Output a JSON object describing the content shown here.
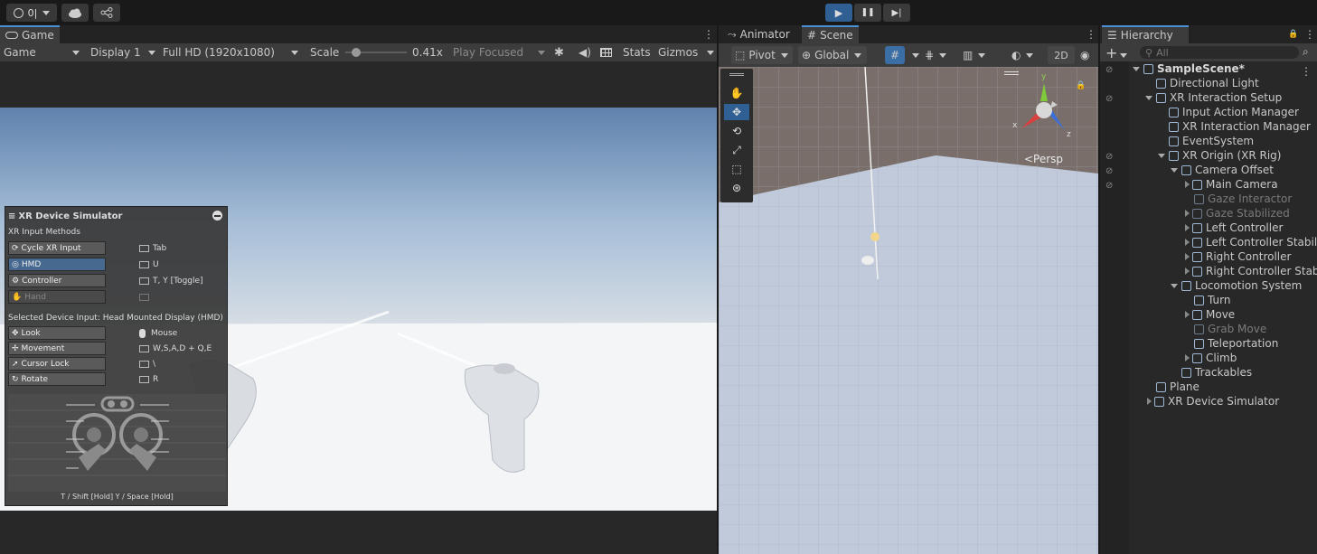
{
  "toolbar": {
    "account_label": "0|",
    "play": "▶",
    "pause": "❚❚",
    "step": "▶|"
  },
  "game": {
    "tab_label": "Game",
    "view_dropdown": "Game",
    "display": "Display 1",
    "resolution": "Full HD (1920x1080)",
    "scale_label": "Scale",
    "scale_value": "0.41x",
    "scale_fraction": 0.12,
    "play_mode": "Play Focused",
    "stats": "Stats",
    "gizmos": "Gizmos"
  },
  "simulator": {
    "title": "XR Device Simulator",
    "input_methods_header": "XR Input Methods",
    "methods": [
      {
        "label": "Cycle XR Input",
        "key": "Tab"
      },
      {
        "label": "HMD",
        "key": "U"
      },
      {
        "label": "Controller",
        "key": "T, Y [Toggle]"
      },
      {
        "label": "Hand",
        "key": ""
      }
    ],
    "selected_header": "Selected Device Input: Head Mounted Display (HMD)",
    "inputs": [
      {
        "label": "Look",
        "key": "Mouse"
      },
      {
        "label": "Movement",
        "key": "W,S,A,D + Q,E"
      },
      {
        "label": "Cursor Lock",
        "key": "\\"
      },
      {
        "label": "Rotate",
        "key": "R"
      }
    ],
    "footer": "T / Shift [Hold]   Y / Space [Hold]"
  },
  "scene": {
    "tabs": [
      "Animator",
      "Scene"
    ],
    "pivot": "Pivot",
    "global": "Global",
    "mode_2d": "2D",
    "persp": "<Persp",
    "axis_x": "x",
    "axis_y": "y",
    "axis_z": "z"
  },
  "hierarchy": {
    "tab_label": "Hierarchy",
    "search_placeholder": "All",
    "items": [
      {
        "label": "SampleScene*",
        "depth": 0,
        "expand": "open",
        "bold": true
      },
      {
        "label": "Directional Light",
        "depth": 1,
        "expand": "none"
      },
      {
        "label": "XR Interaction Setup",
        "depth": 1,
        "expand": "open"
      },
      {
        "label": "Input Action Manager",
        "depth": 2,
        "expand": "none"
      },
      {
        "label": "XR Interaction Manager",
        "depth": 2,
        "expand": "none"
      },
      {
        "label": "EventSystem",
        "depth": 2,
        "expand": "none"
      },
      {
        "label": "XR Origin (XR Rig)",
        "depth": 2,
        "expand": "open"
      },
      {
        "label": "Camera Offset",
        "depth": 3,
        "expand": "open"
      },
      {
        "label": "Main Camera",
        "depth": 4,
        "expand": "closed"
      },
      {
        "label": "Gaze Interactor",
        "depth": 4,
        "expand": "none",
        "dim": true
      },
      {
        "label": "Gaze Stabilized",
        "depth": 4,
        "expand": "closed",
        "dim": true
      },
      {
        "label": "Left Controller",
        "depth": 4,
        "expand": "closed"
      },
      {
        "label": "Left Controller Stabiliz",
        "depth": 4,
        "expand": "closed"
      },
      {
        "label": "Right Controller",
        "depth": 4,
        "expand": "closed"
      },
      {
        "label": "Right Controller Stabi",
        "depth": 4,
        "expand": "closed"
      },
      {
        "label": "Locomotion System",
        "depth": 3,
        "expand": "open"
      },
      {
        "label": "Turn",
        "depth": 4,
        "expand": "none"
      },
      {
        "label": "Move",
        "depth": 4,
        "expand": "closed"
      },
      {
        "label": "Grab Move",
        "depth": 4,
        "expand": "none",
        "dim": true
      },
      {
        "label": "Teleportation",
        "depth": 4,
        "expand": "none"
      },
      {
        "label": "Climb",
        "depth": 4,
        "expand": "closed"
      },
      {
        "label": "Trackables",
        "depth": 3,
        "expand": "none"
      },
      {
        "label": "Plane",
        "depth": 1,
        "expand": "none"
      },
      {
        "label": "XR Device Simulator",
        "depth": 1,
        "expand": "closed"
      }
    ]
  },
  "colors": {
    "accent": "#4d8fd6",
    "play_active": "#2f5f93"
  }
}
